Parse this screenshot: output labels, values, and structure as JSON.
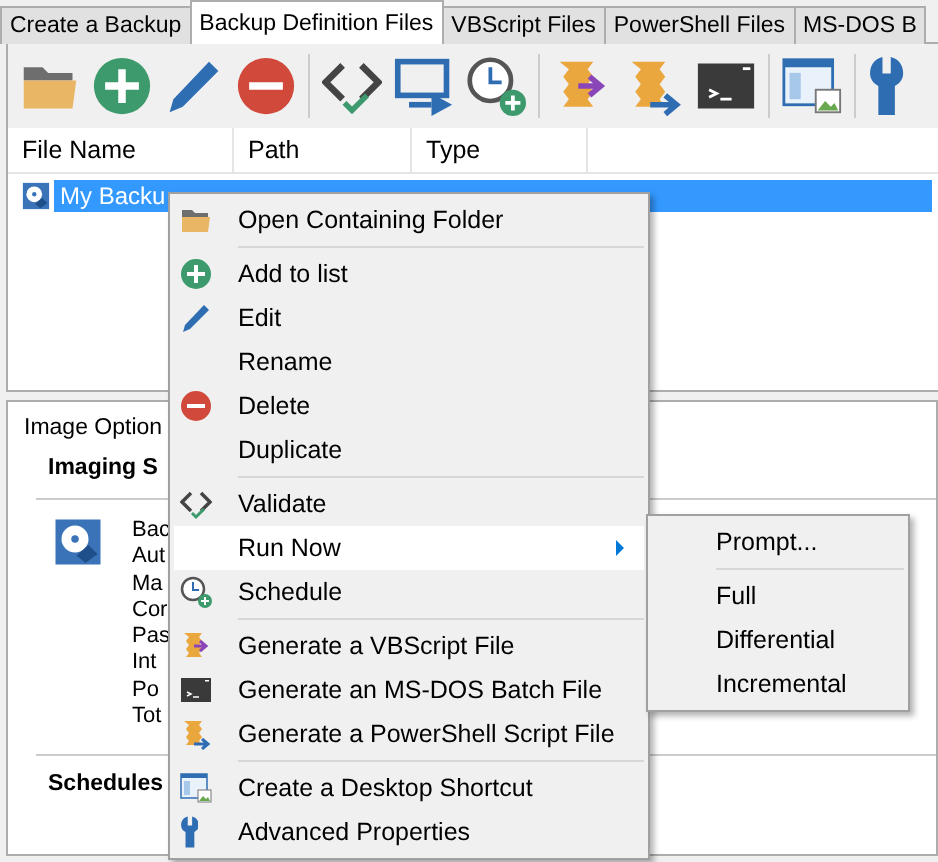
{
  "tabs": [
    {
      "label": "Create a Backup",
      "selected": false
    },
    {
      "label": "Backup Definition Files",
      "selected": true
    },
    {
      "label": "VBScript Files",
      "selected": false
    },
    {
      "label": "PowerShell Files",
      "selected": false
    },
    {
      "label": "MS-DOS B",
      "selected": false
    }
  ],
  "file_list": {
    "columns": [
      "File Name",
      "Path",
      "Type"
    ],
    "rows": [
      {
        "name": "My Backu",
        "selected": true
      }
    ]
  },
  "details": {
    "title": "Image Option",
    "sections": [
      {
        "heading": "Imaging S",
        "lines": [
          "Bac",
          "Aut",
          "Ma",
          "Cor",
          "Pas",
          "Int",
          "Po",
          "Tot"
        ]
      },
      {
        "heading": "Schedules"
      }
    ]
  },
  "context_menu": {
    "items": [
      {
        "kind": "item",
        "label": "Open Containing Folder",
        "selected": false
      },
      {
        "kind": "separator"
      },
      {
        "kind": "item",
        "label": "Add to list",
        "selected": false
      },
      {
        "kind": "item",
        "label": "Edit",
        "selected": false
      },
      {
        "kind": "item",
        "label": "Rename",
        "selected": false
      },
      {
        "kind": "item",
        "label": "Delete",
        "selected": false
      },
      {
        "kind": "item",
        "label": "Duplicate",
        "selected": false
      },
      {
        "kind": "separator"
      },
      {
        "kind": "item",
        "label": "Validate",
        "selected": false
      },
      {
        "kind": "submenu",
        "label": "Run Now",
        "selected": true
      },
      {
        "kind": "item",
        "label": "Schedule",
        "selected": false
      },
      {
        "kind": "separator"
      },
      {
        "kind": "item",
        "label": "Generate a VBScript File",
        "selected": false
      },
      {
        "kind": "item",
        "label": "Generate an MS-DOS Batch File",
        "selected": false
      },
      {
        "kind": "item",
        "label": "Generate a PowerShell Script File",
        "selected": false
      },
      {
        "kind": "separator"
      },
      {
        "kind": "item",
        "label": "Create a Desktop Shortcut",
        "selected": false
      },
      {
        "kind": "item",
        "label": "Advanced Properties",
        "selected": false
      }
    ]
  },
  "submenu": {
    "items": [
      {
        "kind": "item",
        "label": "Prompt..."
      },
      {
        "kind": "separator"
      },
      {
        "kind": "item",
        "label": "Full"
      },
      {
        "kind": "item",
        "label": "Differential"
      },
      {
        "kind": "item",
        "label": "Incremental"
      }
    ]
  }
}
